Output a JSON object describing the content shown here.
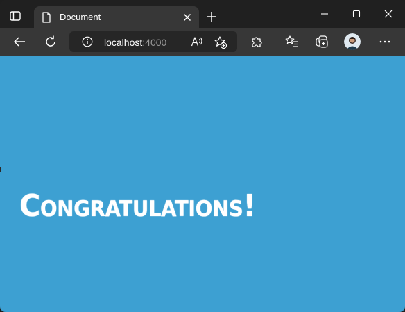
{
  "browser": {
    "tab": {
      "title": "Document"
    },
    "address": {
      "host": "localhost",
      "port": ":4000"
    },
    "icons": {
      "tab_actions": "tab-actions-icon",
      "page": "document-icon",
      "close_tab": "close-icon",
      "new_tab": "plus-icon",
      "minimize": "minimize-icon",
      "maximize": "maximize-icon",
      "close_window": "close-icon",
      "back": "back-arrow-icon",
      "refresh": "refresh-icon",
      "site_info": "info-icon",
      "read_aloud": "read-aloud-icon",
      "add_favorite": "star-plus-icon",
      "extensions": "puzzle-icon",
      "favorites": "favorites-icon",
      "collections": "collections-icon",
      "profile": "avatar",
      "more": "more-icon"
    },
    "colors": {
      "frame": "#202020",
      "toolbar": "#373737",
      "page_background": "#3da0d2",
      "headline": "#ffffff"
    }
  },
  "page": {
    "headline": "Congratulations!"
  }
}
